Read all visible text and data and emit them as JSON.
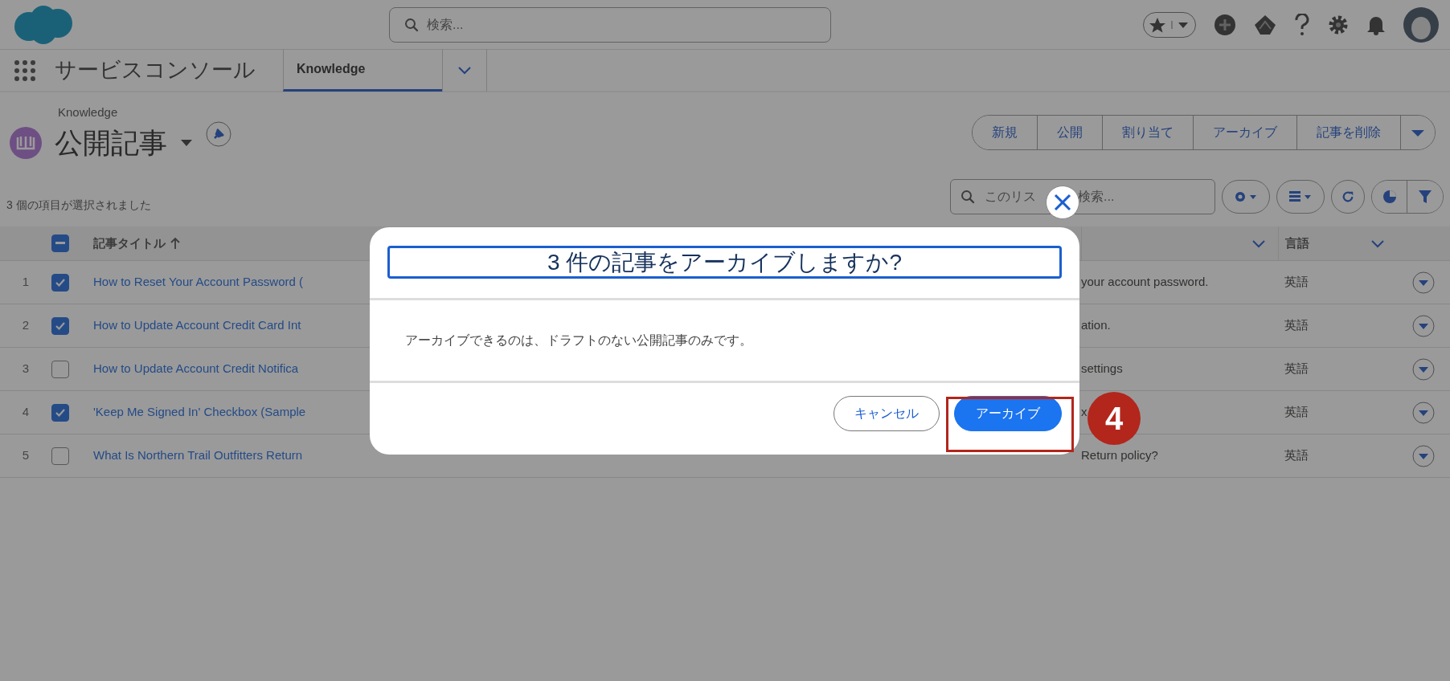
{
  "global_header": {
    "search": {
      "placeholder": "検索..."
    }
  },
  "app_nav": {
    "app_name": "サービスコンソール",
    "tabs": [
      {
        "label": "Knowledge",
        "selected": true
      }
    ]
  },
  "page_header": {
    "object": "Knowledge",
    "title": "公開記事",
    "actions": [
      "新規",
      "公開",
      "割り当て",
      "アーカイブ",
      "記事を削除"
    ]
  },
  "list": {
    "selection_info": "3 個の項目が選択されました",
    "search": {
      "placeholder": "このリス",
      "placeholder_end": "検索..."
    },
    "columns": [
      {
        "label": "記事タイトル",
        "sorted": true
      },
      {},
      {
        "label": "言語"
      }
    ],
    "partially_checked": true,
    "rows": [
      {
        "number": "1",
        "checked": true,
        "title": "How to Reset Your Account Password (",
        "column_2": "your account password.",
        "language": "英語"
      },
      {
        "number": "2",
        "checked": true,
        "title": "How to Update Account Credit Card Int",
        "column_2": "ation.",
        "language": "英語"
      },
      {
        "number": "3",
        "checked": false,
        "title": "How to Update Account Credit Notifica",
        "column_2": "settings",
        "language": "英語"
      },
      {
        "number": "4",
        "checked": true,
        "title": "'Keep Me Signed In' Checkbox (Sample",
        "column_2": "x",
        "language": "英語"
      },
      {
        "number": "5",
        "checked": false,
        "title": "What Is Northern Trail Outfitters Return",
        "column_2": "Return policy?",
        "language": "英語"
      }
    ]
  },
  "modal": {
    "title": "3 件の記事をアーカイブしますか?",
    "body": "アーカイブできるのは、ドラフトのない公開記事のみです。",
    "buttons": [
      {
        "label": "キャンセル",
        "kind": "neutral"
      },
      {
        "label": "アーカイブ",
        "kind": "brand"
      }
    ]
  },
  "callout": {
    "label": "4"
  }
}
